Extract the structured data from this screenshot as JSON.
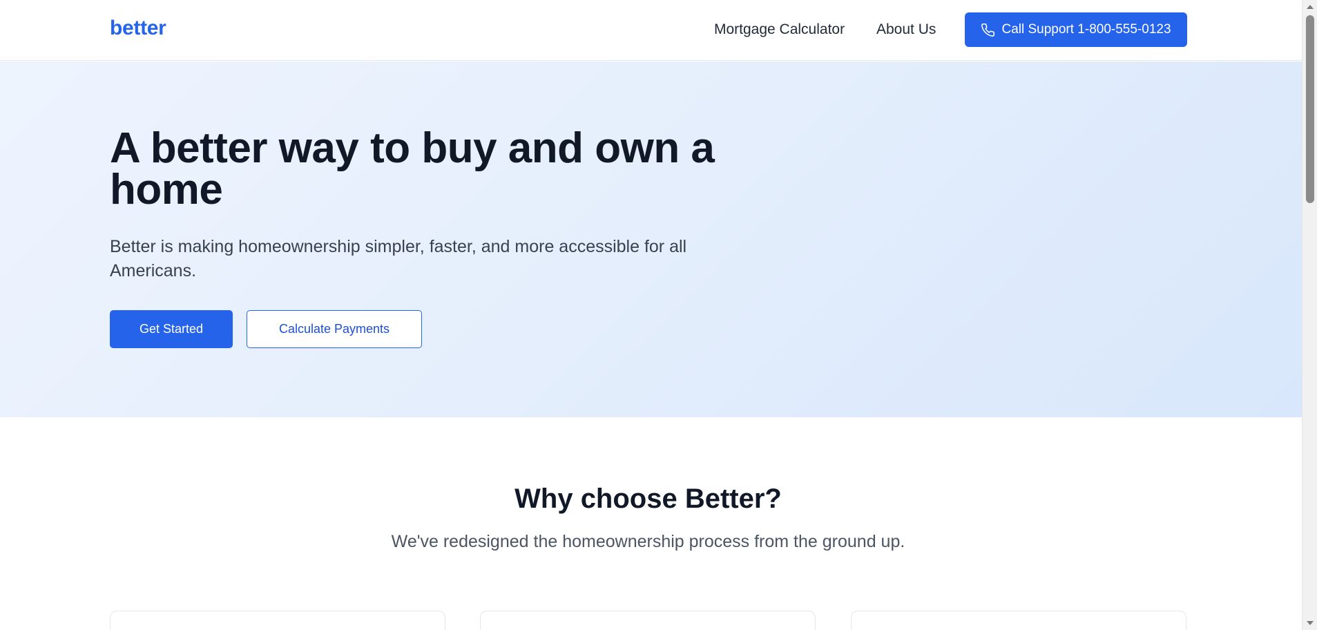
{
  "header": {
    "logo": "better",
    "nav": {
      "mortgage_calculator": "Mortgage Calculator",
      "about_us": "About Us"
    },
    "call_button": {
      "label": "Call Support 1-800-555-0123",
      "icon": "phone-icon"
    }
  },
  "hero": {
    "title": "A better way to buy and own a home",
    "subtitle": "Better is making homeownership simpler, faster, and more accessible for all Americans.",
    "primary_button": "Get Started",
    "secondary_button": "Calculate Payments"
  },
  "features": {
    "title": "Why choose Better?",
    "subtitle": "We've redesigned the homeownership process from the ground up."
  },
  "colors": {
    "brand": "#2563eb",
    "heading": "#111827",
    "body_text": "#374151",
    "hero_bg_start": "#eef4fe",
    "hero_bg_end": "#d8e7fb"
  }
}
